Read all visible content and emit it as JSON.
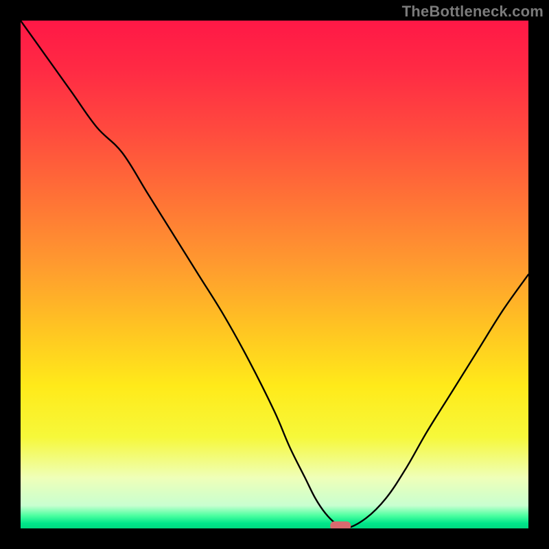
{
  "attribution": "TheBottleneck.com",
  "colors": {
    "gradient_stops": [
      {
        "offset": 0.0,
        "color": "#ff1846"
      },
      {
        "offset": 0.1,
        "color": "#ff2b44"
      },
      {
        "offset": 0.22,
        "color": "#ff4b3e"
      },
      {
        "offset": 0.35,
        "color": "#ff7236"
      },
      {
        "offset": 0.48,
        "color": "#ff9a2f"
      },
      {
        "offset": 0.6,
        "color": "#ffc223"
      },
      {
        "offset": 0.72,
        "color": "#ffea1a"
      },
      {
        "offset": 0.82,
        "color": "#f6f83a"
      },
      {
        "offset": 0.9,
        "color": "#efffb8"
      },
      {
        "offset": 0.955,
        "color": "#c8ffd0"
      },
      {
        "offset": 0.975,
        "color": "#4bffa0"
      },
      {
        "offset": 0.99,
        "color": "#00e68a"
      },
      {
        "offset": 1.0,
        "color": "#00d980"
      }
    ],
    "curve": "#000000",
    "marker": "#d86a6f",
    "frame": "#000000"
  },
  "chart_data": {
    "type": "line",
    "title": "",
    "xlabel": "",
    "ylabel": "",
    "xlim": [
      0,
      100
    ],
    "ylim": [
      0,
      100
    ],
    "grid": false,
    "legend": false,
    "series": [
      {
        "name": "bottleneck-curve",
        "x": [
          0,
          5,
          10,
          15,
          20,
          25,
          30,
          35,
          40,
          45,
          50,
          53,
          56,
          58,
          60,
          62,
          64,
          68,
          72,
          76,
          80,
          85,
          90,
          95,
          100
        ],
        "y": [
          100,
          93,
          86,
          79,
          74,
          66,
          58,
          50,
          42,
          33,
          23,
          16,
          10,
          6,
          3,
          1,
          0,
          2,
          6,
          12,
          19,
          27,
          35,
          43,
          50
        ]
      }
    ],
    "annotations": [
      {
        "name": "optimal-marker",
        "x": 63,
        "y": 0.5,
        "shape": "capsule"
      }
    ]
  }
}
